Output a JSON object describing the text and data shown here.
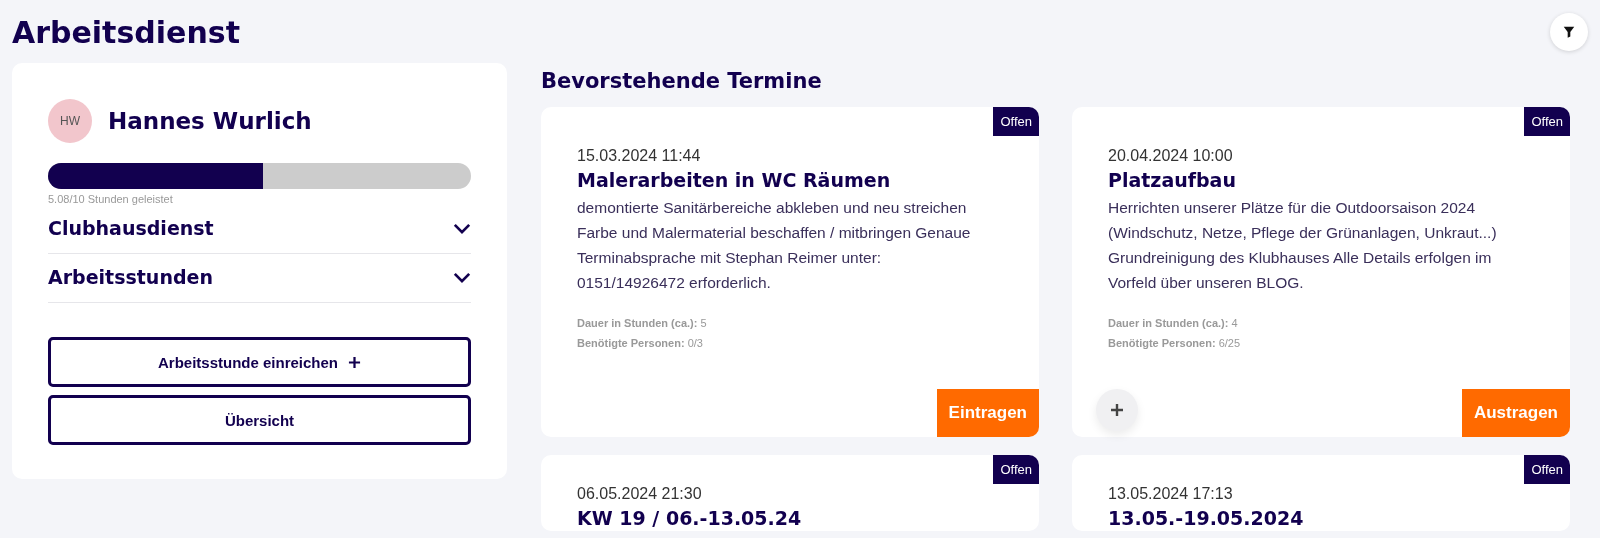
{
  "page_title": "Arbeitsdienst",
  "profile": {
    "initials": "HW",
    "name": "Hannes Wurlich",
    "level": 0.508,
    "progress_label": "5.08/10 Stunden geleistet"
  },
  "sections": [
    {
      "label": "Clubhausdienst",
      "expanded": false
    },
    {
      "label": "Arbeitsstunden",
      "expanded": false
    }
  ],
  "actions": [
    {
      "label": "Arbeitsstunde einreichen",
      "kind": "add"
    },
    {
      "label": "Übersicht",
      "kind": "plain"
    }
  ],
  "upcoming": {
    "heading": "Bevorstehende Termine",
    "cards": [
      {
        "status": "Offen",
        "date": "15.03.2024 11:44",
        "title": "Malerarbeiten in WC Räumen",
        "description": "demontierte Sanitärbereiche abkleben und neu streichen Farbe und Malermaterial beschaffen / mitbringen Genaue Terminabsprache mit Stephan Reimer unter: 0151/14926472 erforderlich.",
        "details": [
          {
            "label": "Dauer in Stunden (ca.):",
            "value": "5"
          },
          {
            "label": "Benötigte Personen:",
            "value": "0/3"
          }
        ],
        "action": "Eintragen",
        "add_button": false
      },
      {
        "status": "Offen",
        "date": "20.04.2024 10:00",
        "title": "Platzaufbau",
        "description": "Herrichten unserer Plätze für die Outdoorsaison 2024 (Windschutz, Netze, Pflege der Grünanlagen, Unkraut...) Grundreinigung des Klubhauses Alle Details erfolgen im Vorfeld über unseren BLOG.",
        "details": [
          {
            "label": "Dauer in Stunden (ca.):",
            "value": "4"
          },
          {
            "label": "Benötigte Personen:",
            "value": "6/25"
          }
        ],
        "action": "Austragen",
        "add_button": true
      },
      {
        "status": "Offen",
        "date": "06.05.2024 21:30",
        "title": "KW 19 / 06.-13.05.24"
      },
      {
        "status": "Offen",
        "date": "13.05.2024 17:13",
        "title": "13.05.-19.05.2024"
      }
    ]
  }
}
